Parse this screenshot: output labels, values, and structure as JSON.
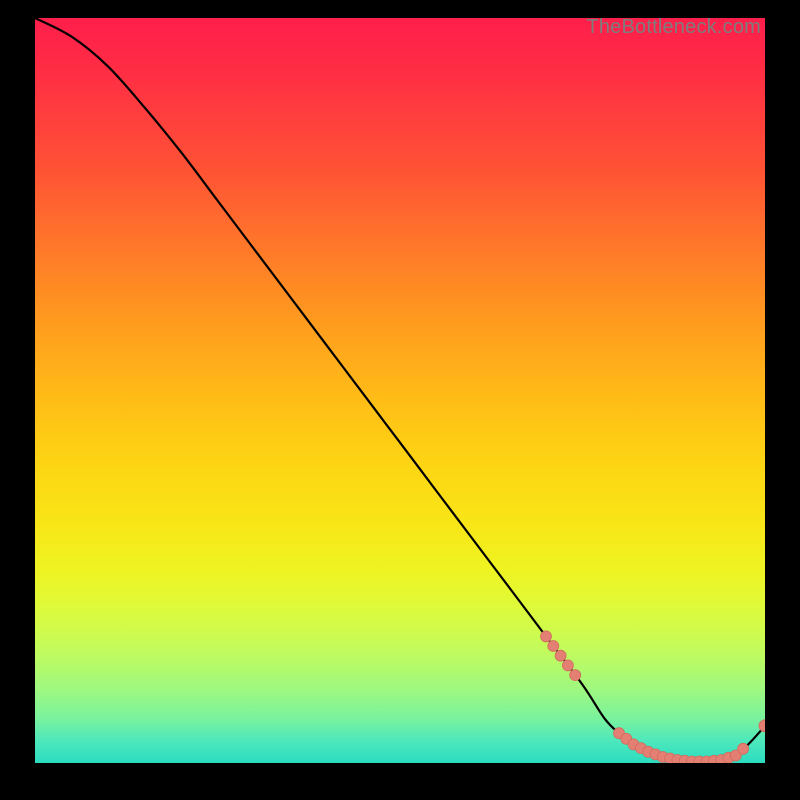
{
  "attribution": "TheBottleneck.com",
  "colors": {
    "curve_stroke": "#000000",
    "marker_fill": "#e47f74",
    "marker_stroke": "#d36b5f",
    "bg": "#000000"
  },
  "chart_data": {
    "type": "line",
    "title": "",
    "xlabel": "",
    "ylabel": "",
    "xlim": [
      0,
      100
    ],
    "ylim": [
      0,
      100
    ],
    "x": [
      0,
      5,
      10,
      15,
      20,
      25,
      30,
      35,
      40,
      45,
      50,
      55,
      60,
      65,
      70,
      75,
      78,
      80,
      82,
      84,
      86,
      88,
      90,
      92,
      94,
      96,
      98,
      100
    ],
    "values": [
      100,
      97.5,
      93.5,
      88.0,
      82.0,
      75.5,
      69.0,
      62.5,
      56.0,
      49.5,
      43.0,
      36.5,
      30.0,
      23.5,
      17.0,
      10.5,
      6.0,
      4.0,
      2.5,
      1.5,
      0.8,
      0.4,
      0.2,
      0.2,
      0.4,
      1.0,
      2.8,
      5.0
    ],
    "highlighted_x": [
      70,
      71,
      72,
      73,
      74,
      80,
      81,
      82,
      83,
      84,
      85,
      86,
      87,
      88,
      89,
      90,
      91,
      92,
      93,
      94,
      95,
      96,
      97,
      100
    ],
    "note": "x and y in percent of plot span; curve descends from top-left, bottoms out near x≈90, slight uptick at right edge; salmon markers cluster along the low-value tail."
  }
}
